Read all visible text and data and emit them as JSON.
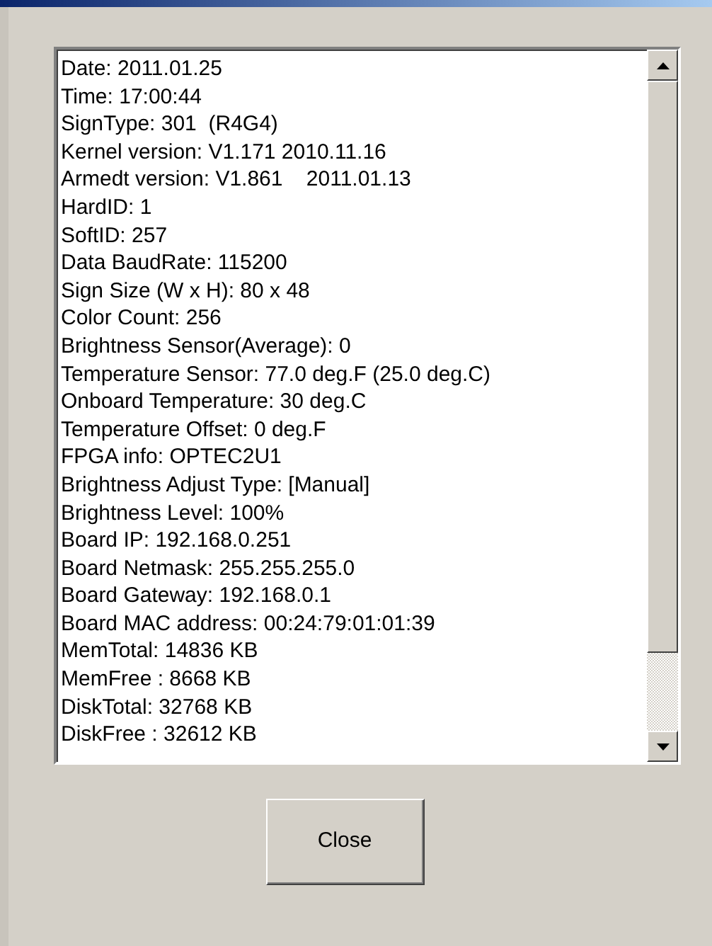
{
  "info_lines": [
    "Date: 2011.01.25",
    "Time: 17:00:44",
    "SignType: 301  (R4G4)",
    "Kernel version: V1.171 2010.11.16",
    "Armedt version: V1.861    2011.01.13",
    "HardID: 1",
    "SoftID: 257",
    "Data BaudRate: 115200",
    "Sign Size (W x H): 80 x 48",
    "Color Count: 256",
    "Brightness Sensor(Average): 0",
    "Temperature Sensor: 77.0 deg.F (25.0 deg.C)",
    "Onboard Temperature: 30 deg.C",
    "Temperature Offset: 0 deg.F",
    "FPGA info: OPTEC2U1",
    "Brightness Adjust Type: [Manual]",
    "Brightness Level: 100%",
    "Board IP: 192.168.0.251",
    "Board Netmask: 255.255.255.0",
    "Board Gateway: 192.168.0.1",
    "Board MAC address: 00:24:79:01:01:39",
    "MemTotal: 14836 KB",
    "MemFree : 8668 KB",
    "DiskTotal: 32768 KB",
    "DiskFree : 32612 KB"
  ],
  "close_button": {
    "label": "Close"
  }
}
